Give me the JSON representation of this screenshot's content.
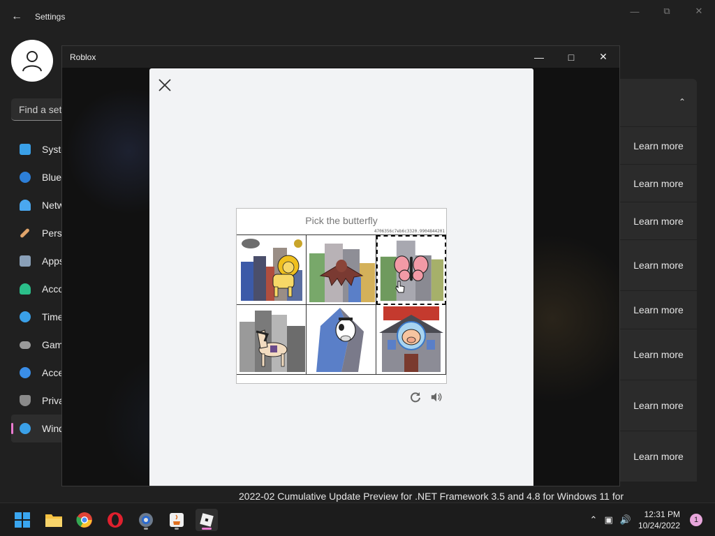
{
  "settings": {
    "title": "Settings",
    "search_placeholder": "Find a setting",
    "nav": [
      {
        "label": "System",
        "icon": "monitor-icon",
        "color": "#3aa0e8"
      },
      {
        "label": "Bluetooth & devices",
        "icon": "bluetooth-icon",
        "color": "#2d7fd8"
      },
      {
        "label": "Network & internet",
        "icon": "wifi-icon",
        "color": "#4aa8f0"
      },
      {
        "label": "Personalization",
        "icon": "brush-icon",
        "color": "#e0a46a"
      },
      {
        "label": "Apps",
        "icon": "apps-icon",
        "color": "#8aa0b8"
      },
      {
        "label": "Accounts",
        "icon": "person-icon",
        "color": "#2bbf8a"
      },
      {
        "label": "Time & language",
        "icon": "clock-globe-icon",
        "color": "#3aa0e8"
      },
      {
        "label": "Gaming",
        "icon": "gamepad-icon",
        "color": "#9a9a9a"
      },
      {
        "label": "Accessibility",
        "icon": "accessibility-icon",
        "color": "#3a8ee8"
      },
      {
        "label": "Privacy & security",
        "icon": "shield-icon",
        "color": "#8a8a8a"
      },
      {
        "label": "Windows Update",
        "icon": "update-icon",
        "color": "#3aa0e8"
      }
    ],
    "learn_more": [
      "Learn more",
      "Learn more",
      "Learn more",
      "Learn more",
      "Learn more",
      "Learn more",
      "Learn more",
      "Learn more"
    ],
    "update_text": "2022-02 Cumulative Update Preview for .NET Framework 3.5 and 4.8 for Windows 11 for"
  },
  "roblox": {
    "title": "Roblox"
  },
  "captcha": {
    "prompt": "Pick the butterfly",
    "hash": "4706356c7eb6c3320.9904844201",
    "tiles": [
      "city-lion",
      "city-bat",
      "city-butterfly",
      "city-horse",
      "city-cow",
      "city-pig"
    ],
    "selected_index": 2
  },
  "taskbar": {
    "apps": [
      "windows-start-icon",
      "file-explorer-icon",
      "chrome-icon",
      "opera-icon",
      "settings-gear-icon",
      "java-icon",
      "roblox-icon"
    ],
    "time": "12:31 PM",
    "date": "10/24/2022",
    "notification_count": "1"
  },
  "colors": {
    "accent": "#ea7bd0",
    "background": "#202020"
  }
}
